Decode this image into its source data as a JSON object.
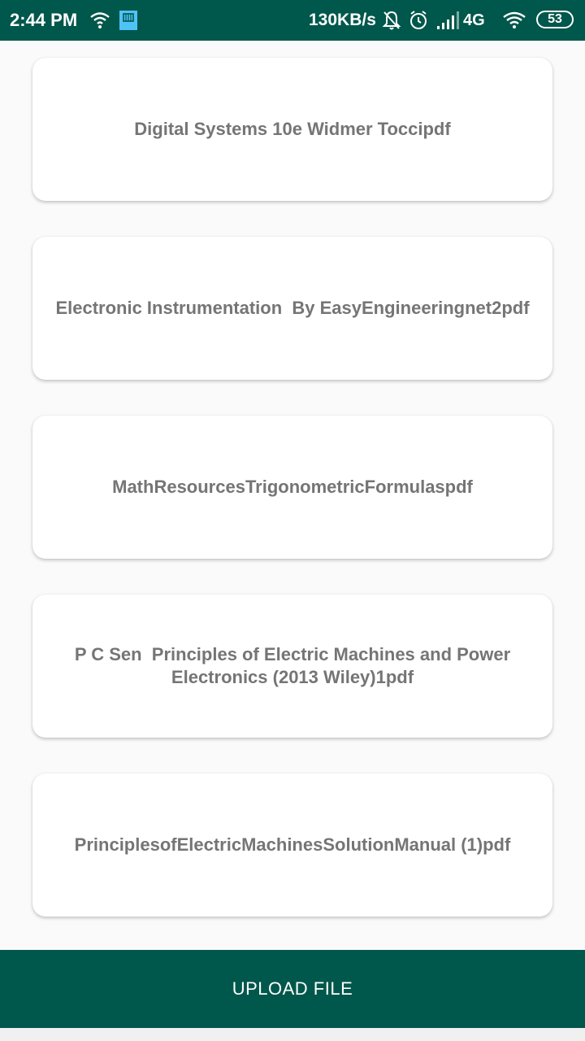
{
  "status_bar": {
    "time": "2:44 PM",
    "network_speed": "130KB/s",
    "network_type": "4G",
    "battery": "53",
    "icons": [
      "wifi-icon",
      "sim-card-icon",
      "bell-off-icon",
      "alarm-icon",
      "signal-icon",
      "wifi-icon",
      "battery-icon"
    ],
    "background_color": "#00574b"
  },
  "files": [
    {
      "name": "Digital Systems 10e Widmer Toccipdf"
    },
    {
      "name": "Electronic Instrumentation  By EasyEngineeringnet2pdf"
    },
    {
      "name": "MathResourcesTrigonometricFormulaspdf"
    },
    {
      "name": "P C Sen  Principles of Electric Machines and Power Electronics (2013 Wiley)1pdf"
    },
    {
      "name": "PrinciplesofElectricMachinesSolutionManual (1)pdf"
    }
  ],
  "upload_button": {
    "label": "UPLOAD FILE",
    "color": "#00574b"
  },
  "colors": {
    "accent": "#00574b",
    "background": "#fafafa",
    "card_text": "#757575"
  }
}
